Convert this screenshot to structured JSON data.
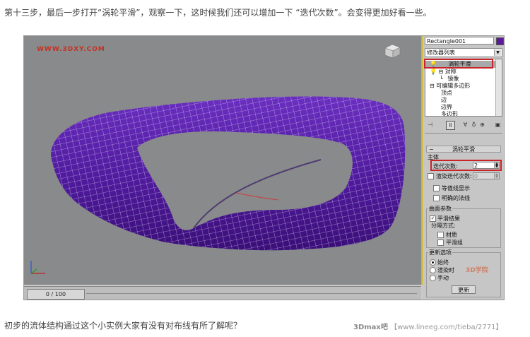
{
  "captions": {
    "top": "第十三步，最后一步打开“涡轮平滑”，观察一下，这时候我们还可以增加一下 “迭代次数”。会变得更加好看一些。",
    "bottom": "初步的流体结构通过这个小实例大家有没有对布线有所了解呢？"
  },
  "page_watermark": {
    "brand": "3Dmax吧",
    "url": "【www.lineeg.com/tieba/2771】"
  },
  "viewport": {
    "logo": "WWW.3DXY.COM",
    "object_color": "#5a1a9a",
    "time_slider": "0 / 100"
  },
  "panel": {
    "object_name": "Rectangle001",
    "modifier_list": "修改器列表",
    "stack": [
      {
        "label": "涡轮平滑",
        "selected": true
      },
      {
        "label": "对称",
        "selected": false
      },
      {
        "label": "镜像",
        "selected": false
      },
      {
        "label": "可编辑多边形",
        "selected": false
      },
      {
        "label": "顶点",
        "selected": false
      },
      {
        "label": "边",
        "selected": false
      },
      {
        "label": "边界",
        "selected": false
      },
      {
        "label": "多边形",
        "selected": false
      }
    ],
    "rollout_title": "涡轮平滑",
    "main_label": "主体",
    "iterations_label": "迭代次数:",
    "iterations_value": "2",
    "render_iters_label": "渲染迭代次数:",
    "render_iters_value": "0",
    "isoline_label": "等值线显示",
    "explicit_normals_label": "明确的法线",
    "surface_params_label": "曲面参数",
    "smooth_result_label": "平滑结果",
    "separate_by_label": "分隔方式:",
    "materials_label": "材质",
    "smoothing_groups_label": "平滑组",
    "update_options_label": "更新选项",
    "always_label": "始终",
    "when_rendering_label": "渲染时",
    "manually_label": "手动",
    "update_button": "更新",
    "panel_watermark": "3D学院"
  }
}
